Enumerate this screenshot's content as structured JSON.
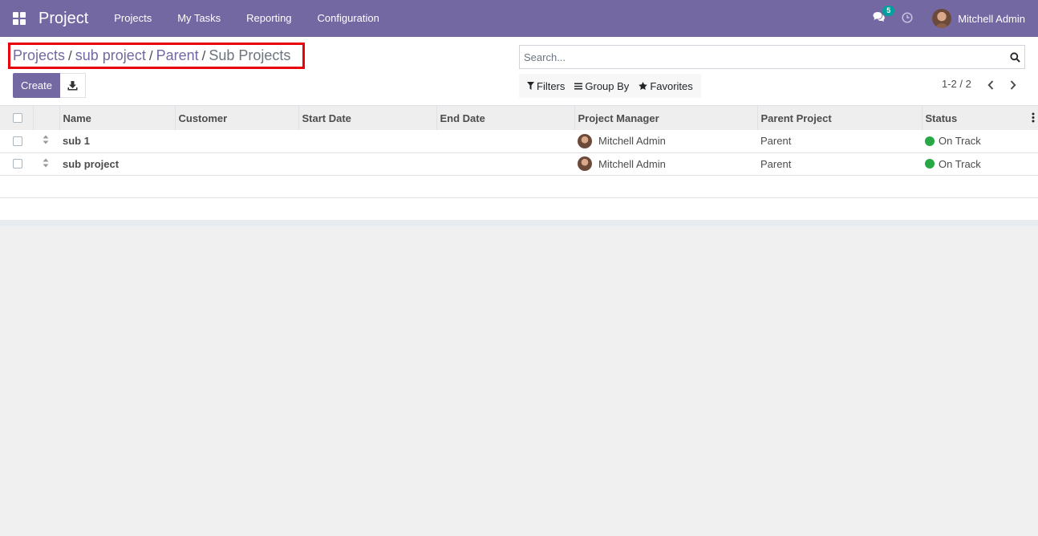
{
  "navbar": {
    "app_name": "Project",
    "menu": [
      "Projects",
      "My Tasks",
      "Reporting",
      "Configuration"
    ],
    "chat_count": "5",
    "user_name": "Mitchell Admin",
    "color": "#7468a3"
  },
  "breadcrumb": {
    "items": [
      "Projects",
      "sub project",
      "Parent"
    ],
    "current": "Sub Projects"
  },
  "toolbar": {
    "create_label": "Create"
  },
  "search": {
    "placeholder": "Search...",
    "filters_label": "Filters",
    "group_by_label": "Group By",
    "favorites_label": "Favorites"
  },
  "pager": {
    "text": "1-2 / 2"
  },
  "table": {
    "columns": [
      "Name",
      "Customer",
      "Start Date",
      "End Date",
      "Project Manager",
      "Parent Project",
      "Status"
    ],
    "rows": [
      {
        "name": "sub 1",
        "customer": "",
        "start_date": "",
        "end_date": "",
        "manager": "Mitchell Admin",
        "parent": "Parent",
        "status": "On Track",
        "status_color": "#28a745"
      },
      {
        "name": "sub project",
        "customer": "",
        "start_date": "",
        "end_date": "",
        "manager": "Mitchell Admin",
        "parent": "Parent",
        "status": "On Track",
        "status_color": "#28a745"
      }
    ]
  }
}
